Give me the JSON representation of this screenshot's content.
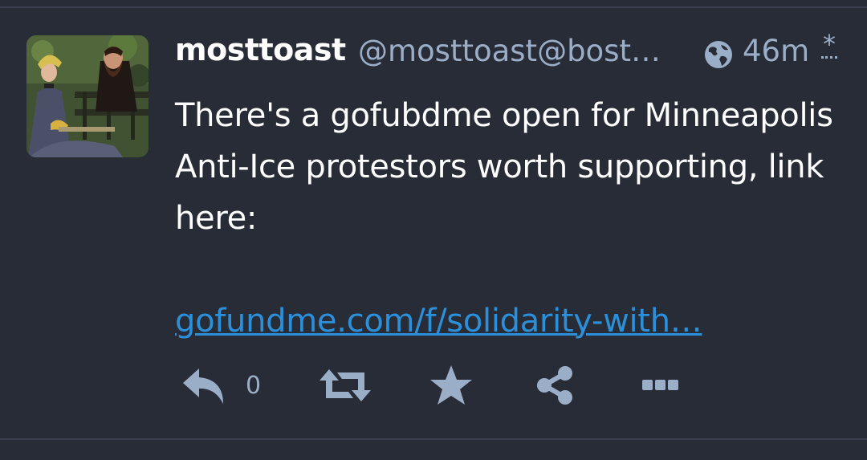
{
  "post": {
    "display_name": "mosttoast",
    "handle": "@mosttoast@bost…",
    "visibility_icon": "globe-icon",
    "timestamp": "46m",
    "edited_marker": "*",
    "content_text": "There's a gofubdme open for Minneapolis Anti-Ice protestors worth supporting, link here:",
    "link_text": "gofundme.com/f/solidarity-with…"
  },
  "actions": {
    "reply_icon": "reply-icon",
    "reply_count": "0",
    "boost_icon": "boost-icon",
    "favourite_icon": "star-icon",
    "share_icon": "share-icon",
    "more_icon": "more-icon"
  },
  "colors": {
    "background": "#282c37",
    "text": "#ffffff",
    "muted": "#9baec8",
    "link": "#2b90d9",
    "divider": "#393f4f"
  }
}
